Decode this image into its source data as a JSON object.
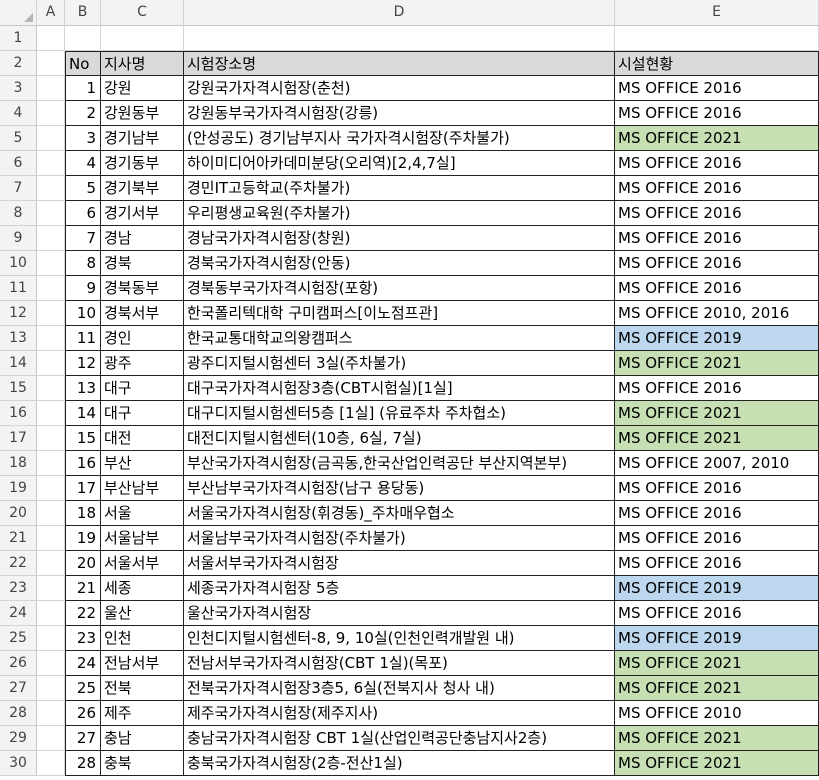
{
  "columns": [
    "A",
    "B",
    "C",
    "D",
    "E"
  ],
  "header": {
    "no": "No",
    "branch": "지사명",
    "site": "시험장소명",
    "facility": "시설현황"
  },
  "rows": [
    {
      "no": "1",
      "branch": "강원",
      "site": "강원국가자격시험장(춘천)",
      "facility": "MS OFFICE 2016",
      "hl": ""
    },
    {
      "no": "2",
      "branch": "강원동부",
      "site": "강원동부국가자격시험장(강릉)",
      "facility": "MS OFFICE 2016",
      "hl": ""
    },
    {
      "no": "3",
      "branch": "경기남부",
      "site": "(안성공도) 경기남부지사 국가자격시험장(주차불가)",
      "facility": "MS OFFICE 2021",
      "hl": "green"
    },
    {
      "no": "4",
      "branch": "경기동부",
      "site": "하이미디어아카데미분당(오리역)[2,4,7실]",
      "facility": "MS OFFICE 2016",
      "hl": ""
    },
    {
      "no": "5",
      "branch": "경기북부",
      "site": "경민IT고등학교(주차불가)",
      "facility": "MS OFFICE 2016",
      "hl": ""
    },
    {
      "no": "6",
      "branch": "경기서부",
      "site": "우리평생교육원(주차불가)",
      "facility": "MS OFFICE 2016",
      "hl": ""
    },
    {
      "no": "7",
      "branch": "경남",
      "site": "경남국가자격시험장(창원)",
      "facility": "MS OFFICE 2016",
      "hl": ""
    },
    {
      "no": "8",
      "branch": "경북",
      "site": "경북국가자격시험장(안동)",
      "facility": "MS OFFICE 2016",
      "hl": ""
    },
    {
      "no": "9",
      "branch": "경북동부",
      "site": "경북동부국가자격시험장(포항)",
      "facility": "MS OFFICE 2016",
      "hl": ""
    },
    {
      "no": "10",
      "branch": "경북서부",
      "site": "한국폴리텍대학 구미캠퍼스[이노점프관]",
      "facility": "MS OFFICE 2010, 2016",
      "hl": ""
    },
    {
      "no": "11",
      "branch": "경인",
      "site": "한국교통대학교의왕캠퍼스",
      "facility": "MS OFFICE 2019",
      "hl": "blue"
    },
    {
      "no": "12",
      "branch": "광주",
      "site": "광주디지털시험센터 3실(주차불가)",
      "facility": "MS OFFICE 2021",
      "hl": "green"
    },
    {
      "no": "13",
      "branch": "대구",
      "site": "대구국가자격시험장3층(CBT시험실)[1실]",
      "facility": "MS OFFICE 2016",
      "hl": ""
    },
    {
      "no": "14",
      "branch": "대구",
      "site": "대구디지털시험센터5층 [1실] (유료주차 주차협소)",
      "facility": "MS OFFICE 2021",
      "hl": "green"
    },
    {
      "no": "15",
      "branch": "대전",
      "site": "대전디지털시험센터(10층, 6실, 7실)",
      "facility": "MS OFFICE 2021",
      "hl": "green"
    },
    {
      "no": "16",
      "branch": "부산",
      "site": "부산국가자격시험장(금곡동,한국산업인력공단 부산지역본부)",
      "facility": "MS OFFICE 2007, 2010",
      "hl": ""
    },
    {
      "no": "17",
      "branch": "부산남부",
      "site": "부산남부국가자격시험장(남구 용당동)",
      "facility": "MS OFFICE 2016",
      "hl": ""
    },
    {
      "no": "18",
      "branch": "서울",
      "site": "서울국가자격시험장(휘경동)_주차매우협소",
      "facility": "MS OFFICE 2016",
      "hl": ""
    },
    {
      "no": "19",
      "branch": "서울남부",
      "site": "서울남부국가자격시험장(주차불가)",
      "facility": "MS OFFICE 2016",
      "hl": ""
    },
    {
      "no": "20",
      "branch": "서울서부",
      "site": "서울서부국가자격시험장",
      "facility": "MS OFFICE 2016",
      "hl": ""
    },
    {
      "no": "21",
      "branch": "세종",
      "site": "세종국가자격시험장 5층",
      "facility": "MS OFFICE 2019",
      "hl": "blue"
    },
    {
      "no": "22",
      "branch": "울산",
      "site": "울산국가자격시험장",
      "facility": "MS OFFICE 2016",
      "hl": ""
    },
    {
      "no": "23",
      "branch": "인천",
      "site": "인천디지털시험센터-8, 9, 10실(인천인력개발원 내)",
      "facility": "MS OFFICE 2019",
      "hl": "blue"
    },
    {
      "no": "24",
      "branch": "전남서부",
      "site": "전남서부국가자격시험장(CBT 1실)(목포)",
      "facility": "MS OFFICE 2021",
      "hl": "green"
    },
    {
      "no": "25",
      "branch": "전북",
      "site": "전북국가자격시험장3층5, 6실(전북지사 청사 내)",
      "facility": "MS OFFICE 2021",
      "hl": "green"
    },
    {
      "no": "26",
      "branch": "제주",
      "site": "제주국가자격시험장(제주지사)",
      "facility": "MS OFFICE 2010",
      "hl": ""
    },
    {
      "no": "27",
      "branch": "충남",
      "site": "충남국가자격시험장 CBT 1실(산업인력공단충남지사2층)",
      "facility": "MS OFFICE 2021",
      "hl": "green"
    },
    {
      "no": "28",
      "branch": "충북",
      "site": "충북국가자격시험장(2층-전산1실)",
      "facility": "MS OFFICE 2021",
      "hl": "green"
    }
  ]
}
